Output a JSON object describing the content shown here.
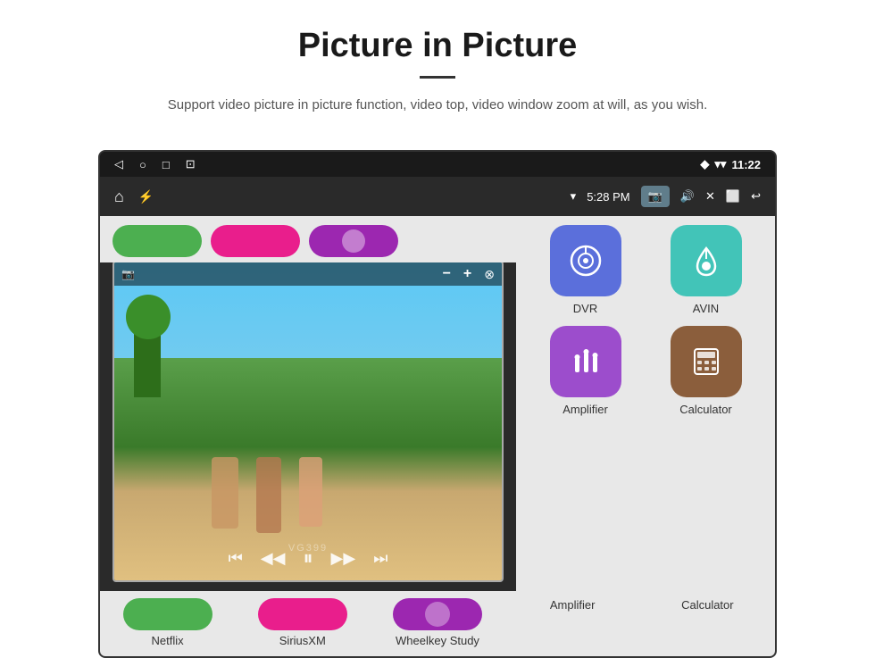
{
  "header": {
    "title": "Picture in Picture",
    "subtitle": "Support video picture in picture function, video top, video window zoom at will, as you wish."
  },
  "status_bar": {
    "left_icons": [
      "back",
      "home",
      "square",
      "download"
    ],
    "time": "11:22",
    "right_icons": [
      "location",
      "wifi",
      "signal"
    ]
  },
  "app_bar": {
    "left_icons": [
      "home",
      "usb"
    ],
    "time": "5:28 PM",
    "right_icons": [
      "camera",
      "volume",
      "close",
      "window",
      "back"
    ]
  },
  "app_grid": {
    "rows": [
      [
        {
          "id": "dvr",
          "label": "DVR",
          "color": "#5b6fdb",
          "icon": "dvr"
        },
        {
          "id": "avin",
          "label": "AVIN",
          "color": "#42c4b8",
          "icon": "avin"
        }
      ],
      [
        {
          "id": "amplifier",
          "label": "Amplifier",
          "color": "#9c4dcc",
          "icon": "amplifier"
        },
        {
          "id": "calculator",
          "label": "Calculator",
          "color": "#8b5e3c",
          "icon": "calculator"
        }
      ]
    ]
  },
  "bottom_apps": [
    {
      "id": "netflix",
      "label": "Netflix",
      "color": "#4caf50"
    },
    {
      "id": "siriusxm",
      "label": "SiriusXM",
      "color": "#e91e8c"
    },
    {
      "id": "wheelkey",
      "label": "Wheelkey Study",
      "color": "#9c27b0"
    }
  ],
  "pip_window": {
    "controls": [
      "minus",
      "plus",
      "close"
    ],
    "media_controls": [
      "rewind",
      "previous",
      "play",
      "next",
      "forward"
    ]
  },
  "watermark": "VG399"
}
